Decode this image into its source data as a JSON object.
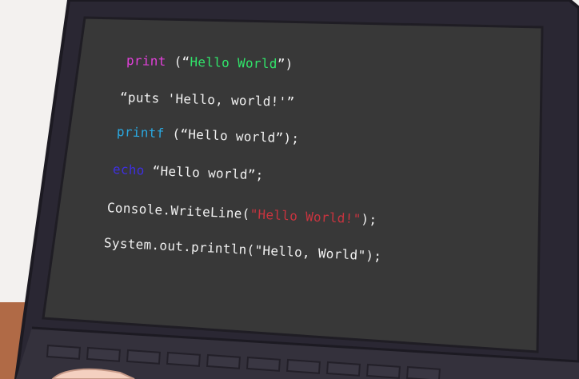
{
  "scene": {
    "colors": {
      "screen": "#383838",
      "bezel": "#2a2733",
      "bezel_outline": "#1c1a22",
      "desk": "#b06a46",
      "wall": "#f3f1ef",
      "hand": "#f4d0c0"
    }
  },
  "code_lines": [
    {
      "keyword": "print",
      "rest_before": " (“",
      "string": "Hello World",
      "rest_after": "”)"
    },
    {
      "text": "“puts 'Hello, world!'”"
    },
    {
      "keyword": "printf",
      "text": " (“Hello world”);"
    },
    {
      "keyword": "echo",
      "text": " “Hello world”;"
    },
    {
      "prefix": "Console.WriteLine(",
      "string": "\"Hello World!\"",
      "suffix": ");"
    },
    {
      "text": "System.out.println(\"Hello, World\");"
    }
  ]
}
